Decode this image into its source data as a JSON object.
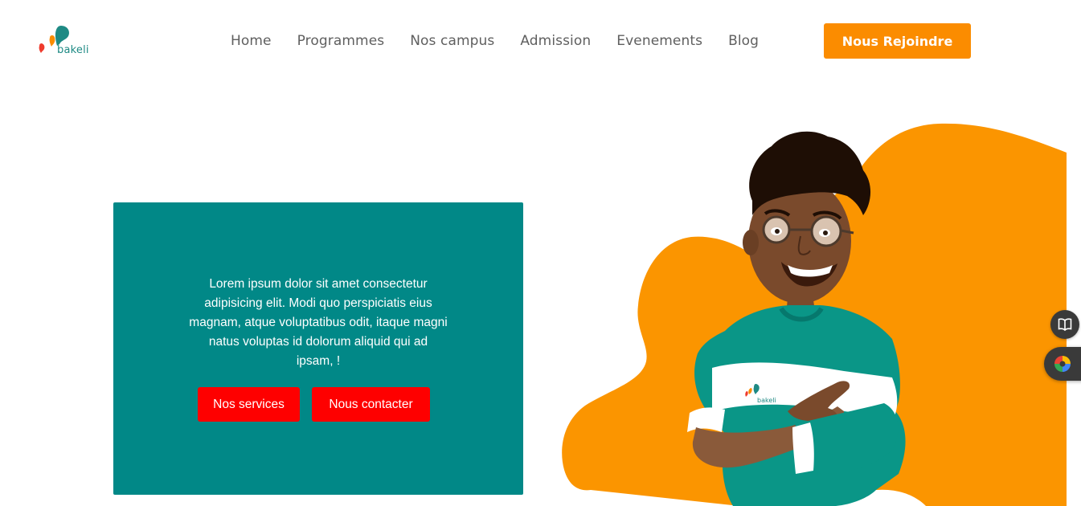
{
  "header": {
    "logo_text": "bakeli",
    "nav": [
      "Home",
      "Programmes",
      "Nos campus",
      "Admission",
      "Evenements",
      "Blog"
    ],
    "cta_label": "Nous Rejoindre"
  },
  "hero": {
    "text": "Lorem ipsum dolor sit amet consectetur adipisicing elit. Modi quo perspiciatis eius magnam, atque voluptatibus odit, itaque magni natus voluptas id dolorum aliquid qui ad ipsam, !",
    "buttons": [
      "Nos services",
      "Nous contacter"
    ]
  },
  "illustration": {
    "shirt_logo_text": "bakeli"
  },
  "side_widgets": [
    "book-icon",
    "color-wheel-icon"
  ],
  "colors": {
    "brand_teal": "#018887",
    "orange": "#fb8c00",
    "red": "#fe0000",
    "nav_text": "#5f5f5f"
  }
}
